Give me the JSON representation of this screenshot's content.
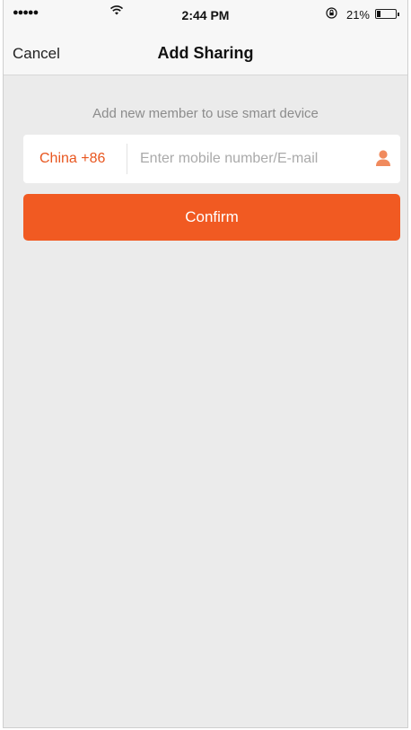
{
  "status_bar": {
    "signal": "●●●●●",
    "wifi_icon": "wifi-icon",
    "time": "2:44 PM",
    "lock_icon": "orientation-lock-icon",
    "battery_percent": "21%",
    "battery_level": 0.21
  },
  "nav": {
    "cancel_label": "Cancel",
    "title": "Add Sharing"
  },
  "form": {
    "instruction": "Add new member to use smart device",
    "country_code": "China +86",
    "contact_value": "",
    "contact_placeholder": "Enter mobile number/E-mail",
    "contact_icon": "person-icon",
    "confirm_label": "Confirm"
  },
  "colors": {
    "accent": "#f15a22",
    "background": "#ebebeb",
    "placeholder": "#aaaaaa",
    "instruction": "#8c8c8c"
  }
}
